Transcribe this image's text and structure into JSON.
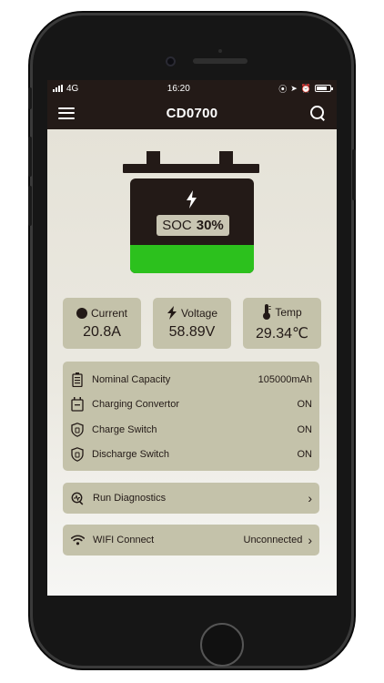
{
  "status_bar": {
    "network": "4G",
    "time": "16:20"
  },
  "header": {
    "title": "CD0700"
  },
  "battery": {
    "soc_label": "SOC",
    "soc_value": "30%",
    "soc_fraction": 0.3,
    "fill_color": "#2cc11d",
    "body_color": "#231a17"
  },
  "metrics": [
    {
      "icon": "current-dot-icon",
      "label": "Current",
      "value": "20.8A"
    },
    {
      "icon": "lightning-icon",
      "label": "Voltage",
      "value": "58.89V"
    },
    {
      "icon": "thermometer-icon",
      "label": "Temp",
      "value": "29.34℃"
    }
  ],
  "info": [
    {
      "icon": "battery-capacity-icon",
      "label": "Nominal Capacity",
      "value": "105000mAh"
    },
    {
      "icon": "charger-icon",
      "label": "Charging Convertor",
      "value": "ON"
    },
    {
      "icon": "shield-icon",
      "label": "Charge Switch",
      "value": "ON"
    },
    {
      "icon": "shield-icon",
      "label": "Discharge Switch",
      "value": "ON"
    }
  ],
  "actions": {
    "diagnostics": {
      "label": "Run Diagnostics"
    },
    "wifi": {
      "label": "WIFI Connect",
      "value": "Unconnected"
    }
  },
  "colors": {
    "header_bg": "#231a17",
    "card_bg": "#c4c2aa",
    "accent_green": "#2cc11d"
  }
}
